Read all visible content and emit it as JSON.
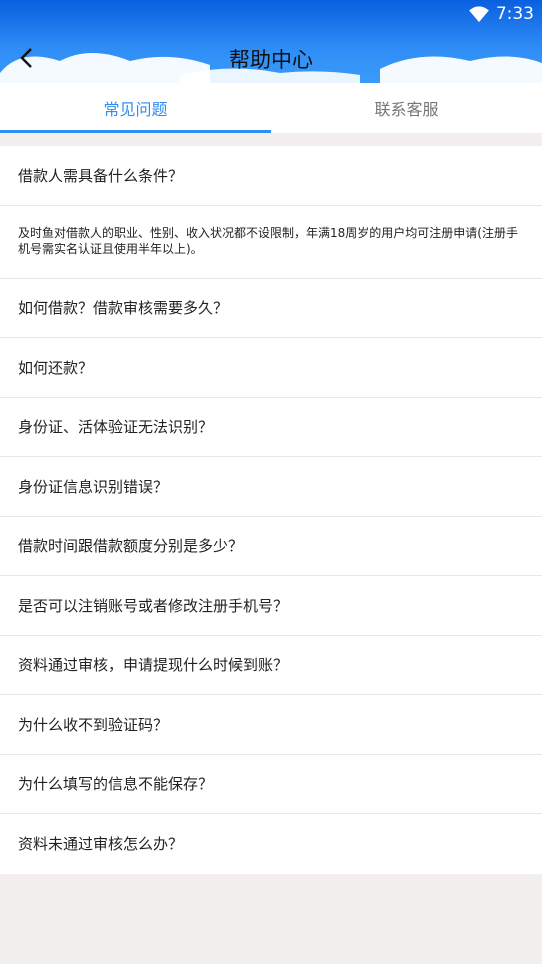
{
  "status_bar": {
    "time": "7:33",
    "wifi_icon": "wifi-icon"
  },
  "header": {
    "title": "帮助中心",
    "back_icon": "back-arrow-icon"
  },
  "tabs": [
    {
      "label": "常见问题",
      "active": true
    },
    {
      "label": "联系客服",
      "active": false
    }
  ],
  "faq": {
    "q1": "借款人需具备什么条件？",
    "a1": "及时鱼对借款人的职业、性别、收入状况都不设限制，年满18周岁的用户均可注册申请(注册手机号需实名认证且使用半年以上)。",
    "q2": "如何借款？借款审核需要多久？",
    "q3": "如何还款？",
    "q4": "身份证、活体验证无法识别？",
    "q5": "身份证信息识别错误？",
    "q6": "借款时间跟借款额度分别是多少？",
    "q7": "是否可以注销账号或者修改注册手机号？",
    "q8": "资料通过审核，申请提现什么时候到账？",
    "q9": "为什么收不到验证码？",
    "q10": "为什么填写的信息不能保存？",
    "q11": "资料未通过审核怎么办？"
  },
  "colors": {
    "primary": "#2f8ef6",
    "header_top": "#0a5fe0",
    "background": "#f2efee"
  }
}
